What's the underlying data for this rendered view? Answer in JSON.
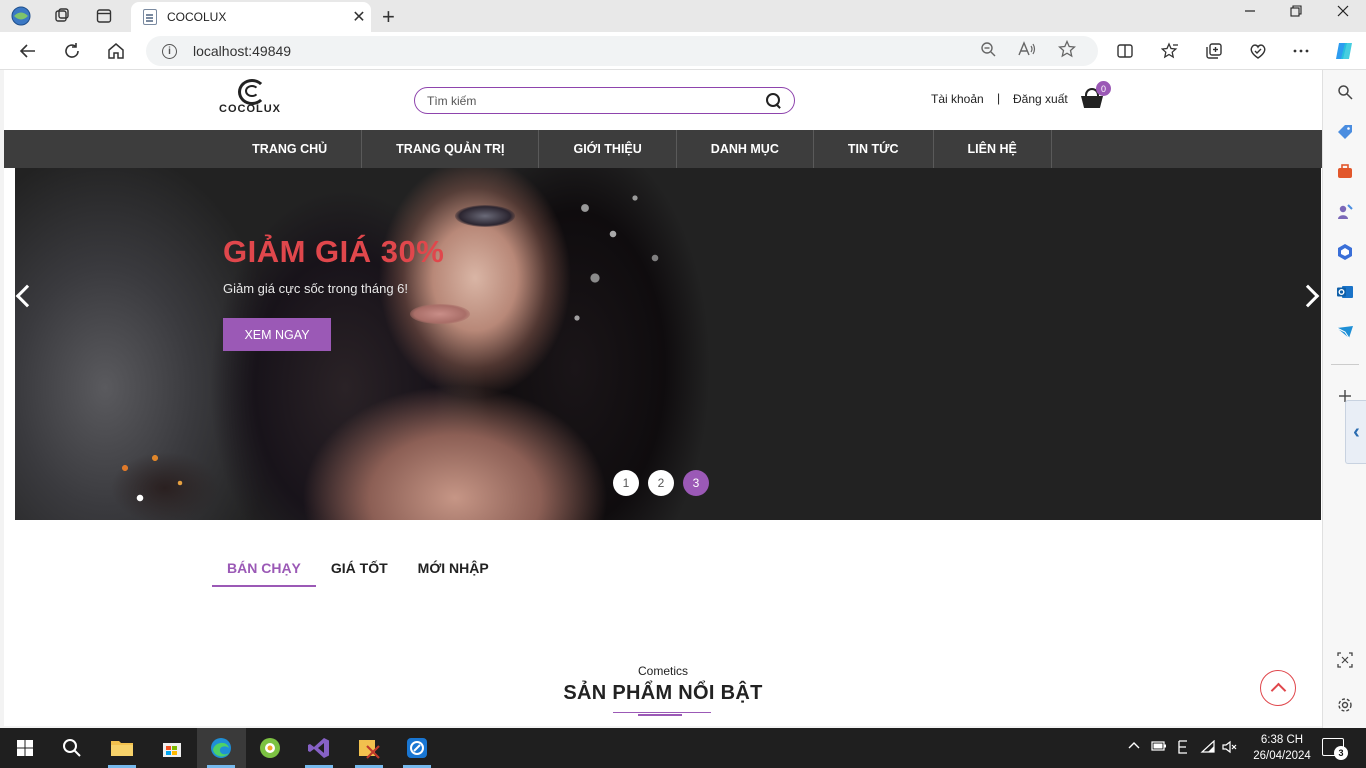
{
  "browser": {
    "tab_title": "COCOLUX",
    "url": "localhost:49849",
    "tab_close": "✕",
    "new_tab": "+"
  },
  "site": {
    "logo_text": "COCOLUX",
    "search_placeholder": "Tìm kiếm",
    "account_label": "Tài khoản",
    "separator": "|",
    "logout_label": "Đăng xuất",
    "cart_count": "0"
  },
  "nav": {
    "items": [
      "TRANG CHỦ",
      "TRANG QUẢN TRỊ",
      "GIỚI THIỆU",
      "DANH MỤC",
      "TIN TỨC",
      "LIÊN HỆ"
    ]
  },
  "hero": {
    "title": "GIẢM GIÁ 30%",
    "subtitle": "Giảm giá cực sốc trong tháng 6!",
    "button_label": "XEM NGAY",
    "slides": [
      "1",
      "2",
      "3"
    ],
    "active_slide": 3,
    "title_color": "#e0474c"
  },
  "product_tabs": {
    "items": [
      "BÁN CHẠY",
      "GIÁ TỐT",
      "MỚI NHẬP"
    ],
    "active": "BÁN CHẠY"
  },
  "featured": {
    "kicker": "Cometics",
    "title": "SẢN PHẨM NỔI BẬT"
  },
  "taskbar": {
    "time": "6:38 CH",
    "date": "26/04/2024",
    "notification_count": "3"
  },
  "colors": {
    "accent": "#9b59b6",
    "nav_bg": "#3d3d3d",
    "sale_red": "#e0474c"
  }
}
